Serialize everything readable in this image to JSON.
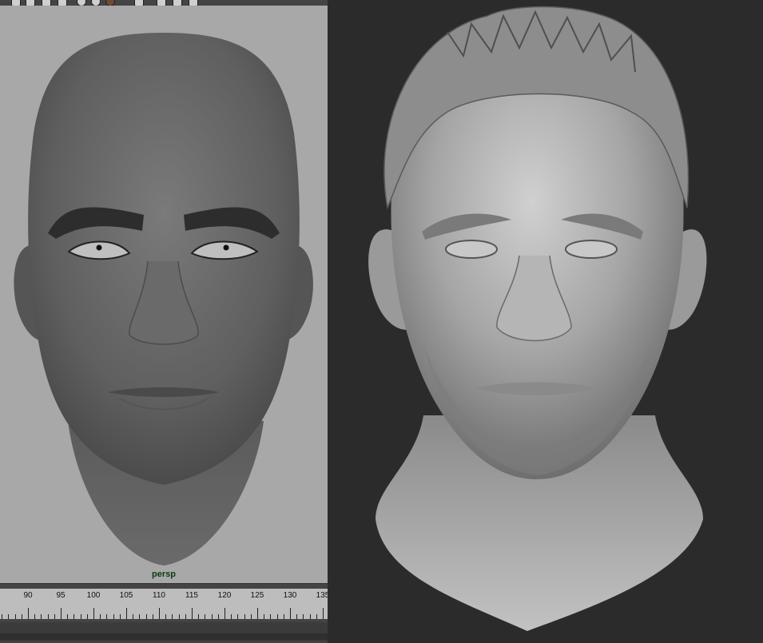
{
  "left_panel": {
    "camera_label": "persp",
    "toolbar_icons": [
      "select-icon",
      "move-icon",
      "rotate-icon",
      "cube-icon",
      "sphere-icon",
      "sphere-icon",
      "sphere-icon",
      "hand-icon",
      "shape-icon",
      "frame-icon",
      "brush-icon"
    ],
    "timeline_labels": [
      "90",
      "95",
      "100",
      "105",
      "110",
      "115",
      "120",
      "125",
      "130",
      "135"
    ]
  },
  "colors": {
    "viewport_bg": "#a8a8a8",
    "camera_label": "#0a3a12",
    "sculpt_bg": "#2b2b2b",
    "timeline_track": "#bdbdbd"
  }
}
